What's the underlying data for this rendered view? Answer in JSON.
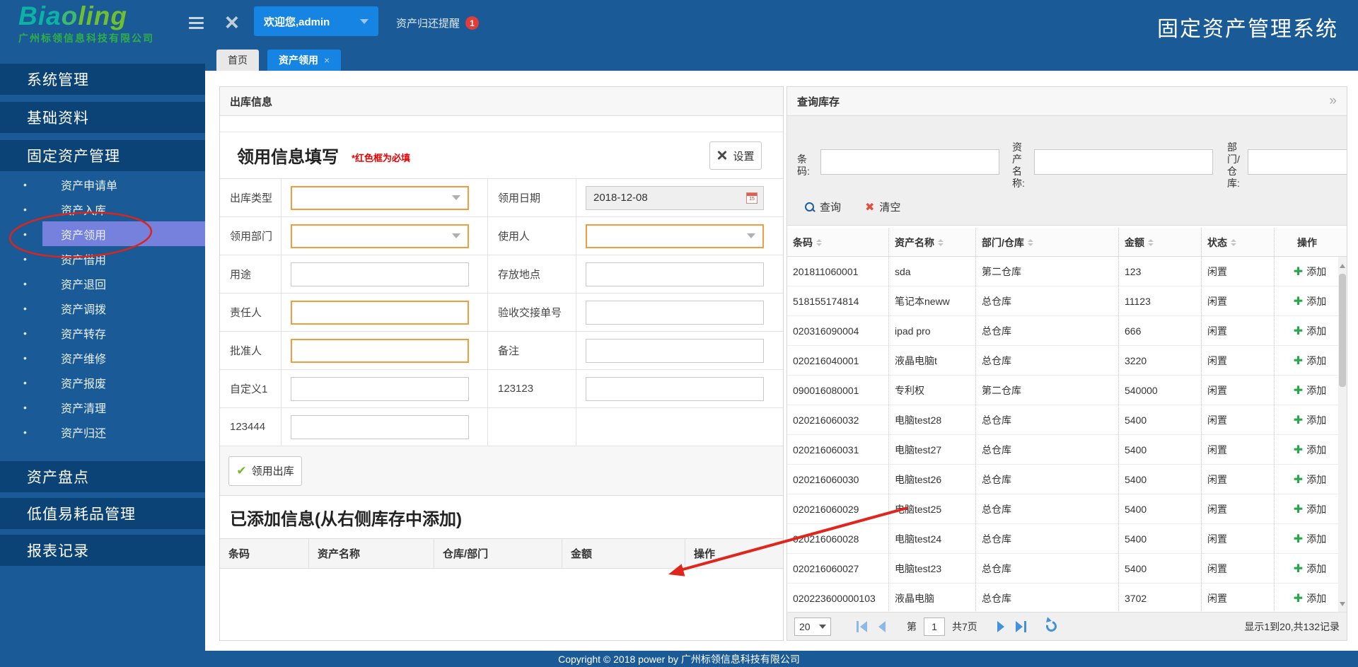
{
  "header": {
    "logo_main_1": "Bia",
    "logo_main_2": "o",
    "logo_main_3": "ling",
    "logo_sub": "广州标领信息科技有限公司",
    "welcome": "欢迎您,admin",
    "reminder": "资产归还提醒",
    "reminder_count": "1",
    "app_title": "固定资产管理系统"
  },
  "tabs": {
    "home": "首页",
    "active_tab": "资产领用",
    "close": "×"
  },
  "sidebar": {
    "sections_top": [
      "系统管理",
      "基础资料",
      "固定资产管理"
    ],
    "menu_items": [
      {
        "label": "资产申请单",
        "selected": false
      },
      {
        "label": "资产入库",
        "selected": false
      },
      {
        "label": "资产领用",
        "selected": true
      },
      {
        "label": "资产借用",
        "selected": false
      },
      {
        "label": "资产退回",
        "selected": false
      },
      {
        "label": "资产调拨",
        "selected": false
      },
      {
        "label": "资产转存",
        "selected": false
      },
      {
        "label": "资产维修",
        "selected": false
      },
      {
        "label": "资产报废",
        "selected": false
      },
      {
        "label": "资产清理",
        "selected": false
      },
      {
        "label": "资产归还",
        "selected": false
      }
    ],
    "sections_bottom": [
      "资产盘点",
      "低值易耗品管理",
      "报表记录"
    ]
  },
  "outbound_panel": {
    "title": "出库信息",
    "form_title": "领用信息填写",
    "required_note": "*红色框为必填",
    "settings_label": "设置",
    "fields": [
      {
        "label": "出库类型"
      },
      {
        "label": "领用日期",
        "value": "2018-12-08"
      },
      {
        "label": "领用部门"
      },
      {
        "label": "使用人"
      },
      {
        "label": "用途"
      },
      {
        "label": "存放地点"
      },
      {
        "label": "责任人"
      },
      {
        "label": "验收交接单号"
      },
      {
        "label": "批准人"
      },
      {
        "label": "备注"
      },
      {
        "label": "自定义1"
      },
      {
        "label": "123123"
      },
      {
        "label": "123444"
      }
    ],
    "submit_label": "领用出库",
    "added_title": "已添加信息(从右侧库存中添加)",
    "added_headers": [
      "条码",
      "资产名称",
      "仓库/部门",
      "金额",
      "操作"
    ]
  },
  "stock_panel": {
    "title": "查询库存",
    "collapse_icon": "»",
    "search": {
      "barcode_label": "条码:",
      "name_label": "资产名称:",
      "dept_label": "部门/仓库:",
      "search_label": "查询",
      "clear_label": "清空"
    },
    "headers": [
      "条码",
      "资产名称",
      "部门/仓库",
      "金额",
      "状态",
      "操作"
    ],
    "rows": [
      {
        "barcode": "201811060001",
        "name": "sda",
        "dept": "第二仓库",
        "amount": "123",
        "status": "闲置",
        "action": "添加"
      },
      {
        "barcode": "518155174814",
        "name": "笔记本neww",
        "dept": "总仓库",
        "amount": "11123",
        "status": "闲置",
        "action": "添加"
      },
      {
        "barcode": "020316090004",
        "name": "ipad pro",
        "dept": "总仓库",
        "amount": "666",
        "status": "闲置",
        "action": "添加"
      },
      {
        "barcode": "020216040001",
        "name": "液晶电脑t",
        "dept": "总仓库",
        "amount": "3220",
        "status": "闲置",
        "action": "添加"
      },
      {
        "barcode": "090016080001",
        "name": "专利权",
        "dept": "第二仓库",
        "amount": "540000",
        "status": "闲置",
        "action": "添加"
      },
      {
        "barcode": "020216060032",
        "name": "电脑test28",
        "dept": "总仓库",
        "amount": "5400",
        "status": "闲置",
        "action": "添加"
      },
      {
        "barcode": "020216060031",
        "name": "电脑test27",
        "dept": "总仓库",
        "amount": "5400",
        "status": "闲置",
        "action": "添加"
      },
      {
        "barcode": "020216060030",
        "name": "电脑test26",
        "dept": "总仓库",
        "amount": "5400",
        "status": "闲置",
        "action": "添加"
      },
      {
        "barcode": "020216060029",
        "name": "电脑test25",
        "dept": "总仓库",
        "amount": "5400",
        "status": "闲置",
        "action": "添加"
      },
      {
        "barcode": "020216060028",
        "name": "电脑test24",
        "dept": "总仓库",
        "amount": "5400",
        "status": "闲置",
        "action": "添加"
      },
      {
        "barcode": "020216060027",
        "name": "电脑test23",
        "dept": "总仓库",
        "amount": "5400",
        "status": "闲置",
        "action": "添加"
      },
      {
        "barcode": "020223600000103",
        "name": "液晶电脑",
        "dept": "总仓库",
        "amount": "3702",
        "status": "闲置",
        "action": "添加"
      }
    ],
    "pagination": {
      "page_size": "20",
      "label_page": "第",
      "page_value": "1",
      "label_total": "共7页",
      "summary": "显示1到20,共132记录"
    }
  },
  "footer": {
    "copyright": "Copyright © 2018 power by 广州标领信息科技有限公司"
  },
  "colors": {
    "header_blue": "#1a5b97",
    "band_blue": "#0c4377",
    "active_blue": "#1584e2",
    "selected_item": "#7680dd",
    "required_orange": "#ef9d3d",
    "badge_red": "#e23c39",
    "add_green": "#27a74a",
    "annotation_red": "#d9261c"
  }
}
